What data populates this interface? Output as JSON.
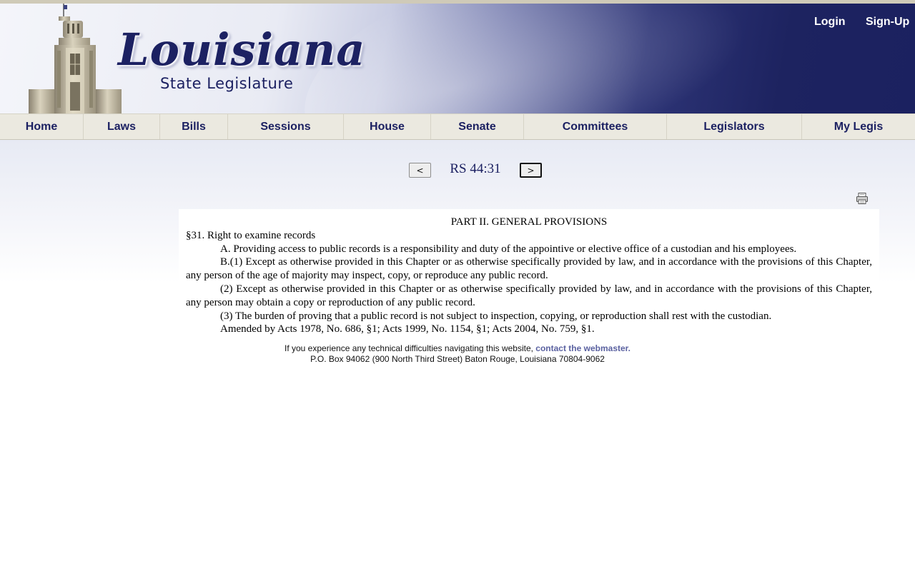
{
  "header": {
    "logo_title": "Louisiana",
    "logo_subtitle": "State Legislature",
    "login_label": "Login",
    "signup_label": "Sign-Up"
  },
  "nav": {
    "items": [
      {
        "label": "Home"
      },
      {
        "label": "Laws"
      },
      {
        "label": "Bills"
      },
      {
        "label": "Sessions"
      },
      {
        "label": "House"
      },
      {
        "label": "Senate"
      },
      {
        "label": "Committees"
      },
      {
        "label": "Legislators"
      },
      {
        "label": "My Legis"
      }
    ]
  },
  "pager": {
    "prev_label": "<",
    "title": "RS 44:31",
    "next_label": ">"
  },
  "document": {
    "heading": "PART II.  GENERAL PROVISIONS",
    "section": "§31.  Right to examine records",
    "paragraphs": [
      "A.  Providing access to public records is a responsibility and duty of the appointive or elective office of a custodian and his employees.",
      "B.(1)  Except as otherwise provided in this Chapter or as otherwise specifically provided by law, and in accordance with the provisions of this Chapter, any person of the age of majority may inspect, copy, or reproduce any public record.",
      "(2)  Except as otherwise provided in this Chapter or as otherwise specifically provided by law, and in accordance with the provisions of this Chapter, any person may obtain a copy or reproduction of any public record.",
      "(3)  The burden of proving that a public record is not subject to inspection, copying, or reproduction shall rest with the custodian.",
      "Amended by Acts 1978, No. 686, §1; Acts 1999, No. 1154, §1; Acts 2004, No. 759, §1."
    ]
  },
  "footer": {
    "text": "If you experience any technical difficulties navigating this website, ",
    "link_label": "contact the webmaster.",
    "address": "P.O. Box 94062 (900 North Third Street) Baton Rouge, Louisiana 70804-9062"
  },
  "colors": {
    "brand_navy": "#1c2162",
    "nav_bg": "#ebe9e0",
    "link": "#5a61a0"
  }
}
